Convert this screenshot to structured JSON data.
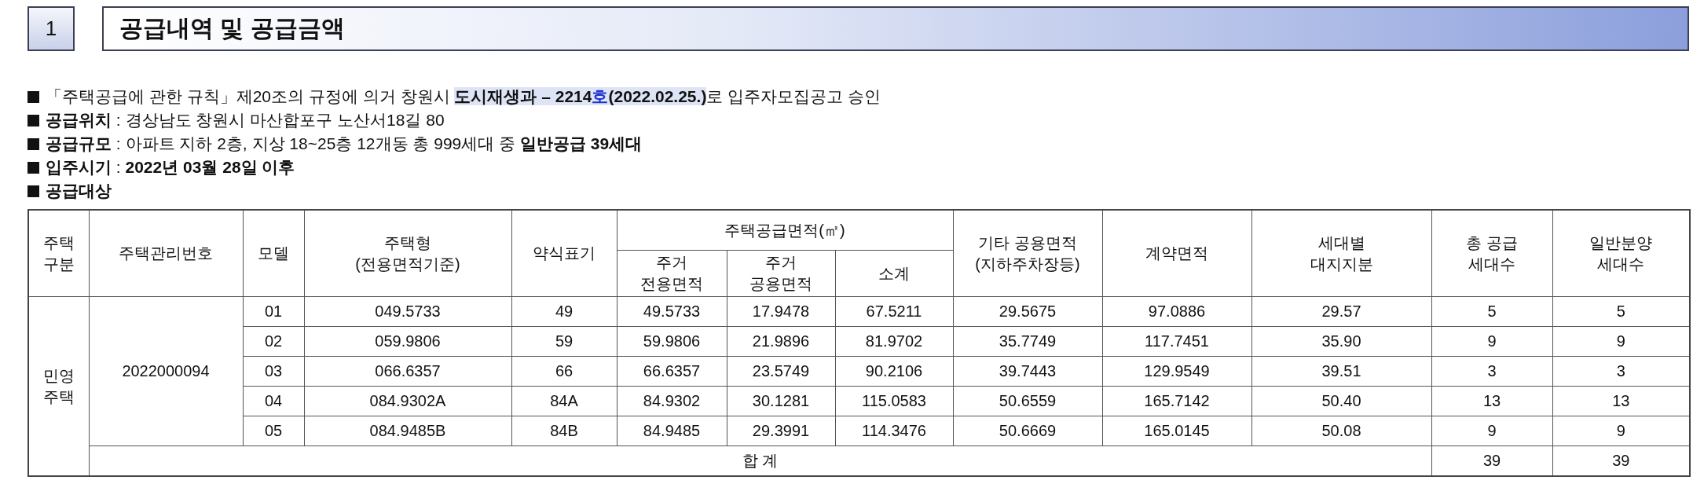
{
  "section": {
    "number": "1",
    "title": "공급내역 및 공급금액"
  },
  "notes": [
    {
      "parts": [
        {
          "kind": "plain",
          "text": "「주택공급에 관한 규칙」제20조의 규정에 의거 창원시 "
        },
        {
          "kind": "highlight",
          "text": "**도시재생과 – 2214**"
        },
        {
          "kind": "highlight-blue",
          "text": "**호**"
        },
        {
          "kind": "highlight",
          "text": "**(2022.02.25.)**"
        },
        {
          "kind": "plain",
          "text": "로 입주자모집공고 승인"
        }
      ]
    },
    {
      "parts": [
        {
          "kind": "plain",
          "text": "**공급위치** : 경상남도 창원시 마산합포구 노산서18길 80"
        }
      ]
    },
    {
      "parts": [
        {
          "kind": "plain",
          "text": "**공급규모** : 아파트 지하 2층, 지상 18~25층 12개동 총 999세대 중 **일반공급 39세대**"
        }
      ]
    },
    {
      "parts": [
        {
          "kind": "plain",
          "text": "**입주시기** : **2022년 03월 28일 이후**"
        }
      ]
    },
    {
      "parts": [
        {
          "kind": "plain",
          "text": "**공급대상**"
        }
      ]
    }
  ],
  "table": {
    "header_top": [
      {
        "lines": [
          "주택",
          "구분"
        ]
      },
      {
        "lines": [
          "주택관리번호"
        ]
      },
      {
        "lines": [
          "모델"
        ]
      },
      {
        "lines": [
          "주택형",
          "(전용면적기준)"
        ]
      },
      {
        "lines": [
          "약식표기"
        ]
      },
      {
        "lines": [
          "주택공급면적(㎡)"
        ],
        "kind": "group"
      },
      {
        "lines": [
          "기타 공용면적",
          "(지하주차장등)"
        ]
      },
      {
        "lines": [
          "계약면적"
        ]
      },
      {
        "lines": [
          "세대별",
          "대지지분"
        ]
      },
      {
        "lines": [
          "총 공급",
          "세대수"
        ]
      },
      {
        "lines": [
          "일반분양",
          "세대수"
        ]
      }
    ],
    "header_sub": [
      {
        "lines": [
          "주거",
          "전용면적"
        ]
      },
      {
        "lines": [
          "주거",
          "공용면적"
        ]
      },
      {
        "lines": [
          "소계"
        ]
      }
    ],
    "housing_type": "민영 주택",
    "management_number": "2022000094",
    "rows": [
      [
        "01",
        "049.5733",
        "49",
        "49.5733",
        "17.9478",
        "67.5211",
        "29.5675",
        "97.0886",
        "29.57",
        "5",
        "5"
      ],
      [
        "02",
        "059.9806",
        "59",
        "59.9806",
        "21.9896",
        "81.9702",
        "35.7749",
        "117.7451",
        "35.90",
        "9",
        "9"
      ],
      [
        "03",
        "066.6357",
        "66",
        "66.6357",
        "23.5749",
        "90.2106",
        "39.7443",
        "129.9549",
        "39.51",
        "3",
        "3"
      ],
      [
        "04",
        "084.9302A",
        "84A",
        "84.9302",
        "30.1281",
        "115.0583",
        "50.6559",
        "165.7142",
        "50.40",
        "13",
        "13"
      ],
      [
        "05",
        "084.9485B",
        "84B",
        "84.9485",
        "29.3991",
        "114.3476",
        "50.6669",
        "165.0145",
        "50.08",
        "9",
        "9"
      ]
    ],
    "total": {
      "label": "합 계",
      "values": [
        "39",
        "39"
      ]
    }
  }
}
